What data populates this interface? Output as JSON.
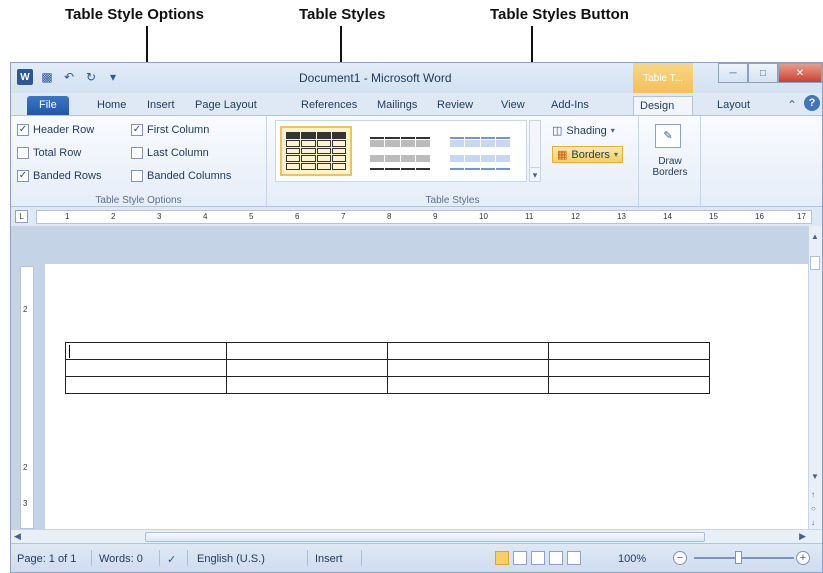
{
  "annotations": {
    "table_style_options": "Table Style Options",
    "table_styles": "Table Styles",
    "table_styles_button": "Table Styles Button"
  },
  "titlebar": {
    "title": "Document1 - Microsoft Word",
    "contextual_tab": "Table T...",
    "app_icon_letter": "W",
    "qat_icons": [
      "save-icon",
      "undo-icon",
      "redo-icon",
      "customize-icon"
    ]
  },
  "tabs": [
    "File",
    "Home",
    "Insert",
    "Page Layout",
    "References",
    "Mailings",
    "Review",
    "View",
    "Add-Ins",
    "Design",
    "Layout"
  ],
  "active_tab": "Design",
  "ribbon": {
    "style_options": {
      "label": "Table Style Options",
      "checkboxes": [
        {
          "label": "Header Row",
          "checked": true
        },
        {
          "label": "First Column",
          "checked": true
        },
        {
          "label": "Total Row",
          "checked": false
        },
        {
          "label": "Last Column",
          "checked": false
        },
        {
          "label": "Banded Rows",
          "checked": true
        },
        {
          "label": "Banded Columns",
          "checked": false
        }
      ]
    },
    "table_styles": {
      "label": "Table Styles",
      "shading": "Shading",
      "borders": "Borders"
    },
    "draw_borders": {
      "line1": "Draw",
      "line2": "Borders"
    }
  },
  "ruler": {
    "numbers": [
      "1",
      "2",
      "3",
      "4",
      "5",
      "6",
      "7",
      "8",
      "9",
      "10",
      "11",
      "12",
      "13",
      "14",
      "15",
      "16",
      "17"
    ],
    "vnumbers": [
      "2",
      "2",
      "3"
    ]
  },
  "document": {
    "table_rows": 3,
    "table_cols": 4
  },
  "statusbar": {
    "page": "Page: 1 of 1",
    "words": "Words: 0",
    "language": "English (U.S.)",
    "mode": "Insert",
    "zoom": "100%"
  }
}
